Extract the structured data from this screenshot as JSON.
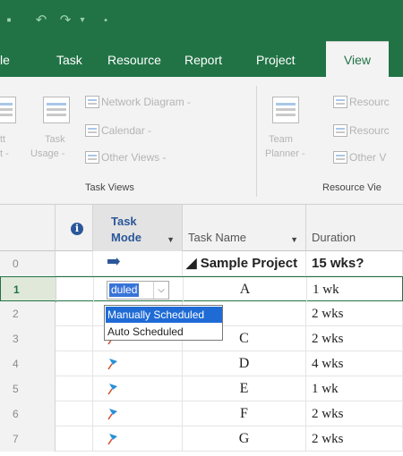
{
  "app": {
    "accent": "#217346"
  },
  "ribbon_tabs": [
    {
      "label": "le"
    },
    {
      "label": "Task"
    },
    {
      "label": "Resource"
    },
    {
      "label": "Report"
    },
    {
      "label": "Project"
    },
    {
      "label": "View",
      "active": true
    }
  ],
  "task_views": {
    "gantt_label_top": "tt",
    "gantt_label_bottom": "t -",
    "task_usage_label_top": "Task",
    "task_usage_label_bottom": "Usage -",
    "network_diagram": "Network Diagram -",
    "calendar": "Calendar -",
    "other_views": "Other Views -",
    "group_label": "Task Views"
  },
  "resource_views": {
    "team_planner_top": "Team",
    "team_planner_bottom": "Planner -",
    "resource_sheet": "Resourc",
    "resource_usage": "Resourc",
    "other_views": "Other V",
    "group_label": "Resource Vie"
  },
  "grid": {
    "columns": {
      "info_icon": "i",
      "task_mode_line1": "Task",
      "task_mode_line2": "Mode",
      "task_name": "Task Name",
      "duration": "Duration"
    },
    "rows": [
      {
        "id": "0",
        "mode": "auto",
        "name": "◢ Sample Project",
        "duration": "15 wks?",
        "summary": true
      },
      {
        "id": "1",
        "mode": "editing",
        "name": "A",
        "duration": "1 wk",
        "selected": true
      },
      {
        "id": "2",
        "mode": "manual",
        "name": "",
        "duration": "2 wks"
      },
      {
        "id": "3",
        "mode": "manual",
        "name": "C",
        "duration": "2 wks"
      },
      {
        "id": "4",
        "mode": "manual",
        "name": "D",
        "duration": "4 wks"
      },
      {
        "id": "5",
        "mode": "manual",
        "name": "E",
        "duration": "1 wk"
      },
      {
        "id": "6",
        "mode": "manual",
        "name": "F",
        "duration": "2 wks"
      },
      {
        "id": "7",
        "mode": "manual",
        "name": "G",
        "duration": "2 wks"
      }
    ]
  },
  "mode_editor": {
    "current_value": "duled",
    "options": [
      "Manually Scheduled",
      "Auto Scheduled"
    ],
    "selected_option": "Manually Scheduled"
  }
}
